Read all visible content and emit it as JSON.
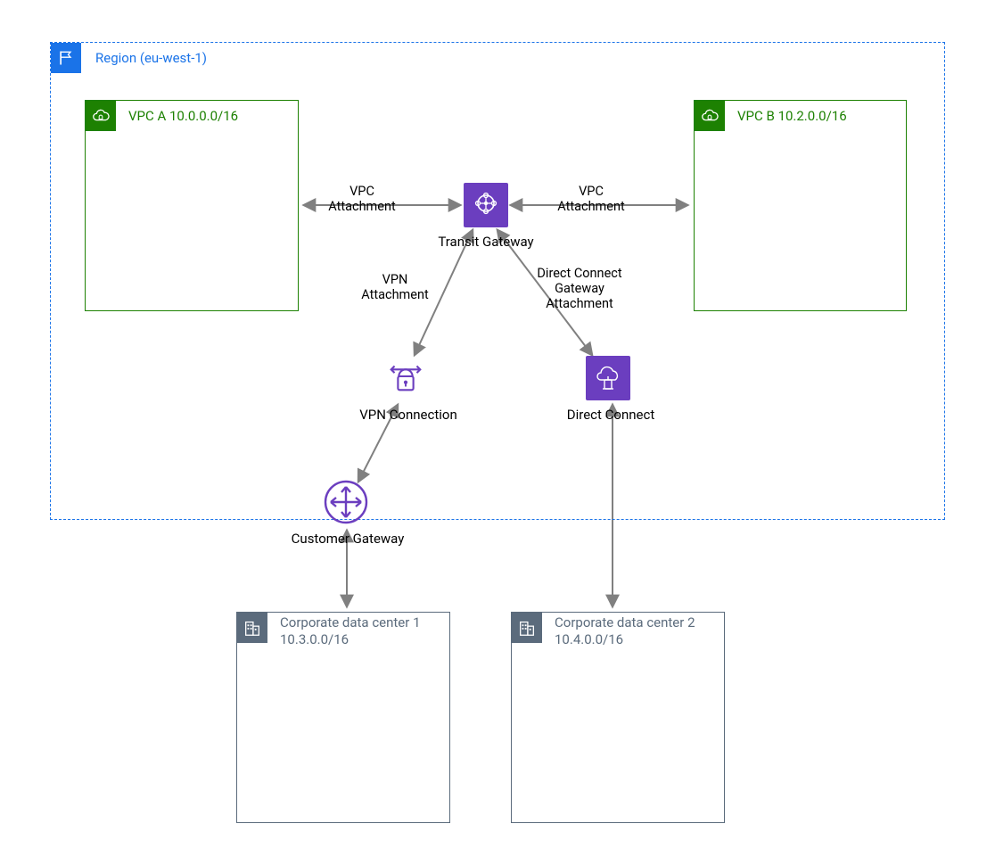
{
  "region": {
    "label": "Region (eu-west-1)"
  },
  "vpc_a": {
    "label": "VPC A 10.0.0.0/16"
  },
  "vpc_b": {
    "label": "VPC B 10.2.0.0/16"
  },
  "tgw": {
    "label": "Transit Gateway"
  },
  "vpn_conn": {
    "label": "VPN Connection"
  },
  "direct_connect": {
    "label": "Direct Connect"
  },
  "customer_gateway": {
    "label": "Customer Gateway"
  },
  "dc1": {
    "title": "Corporate data center 1",
    "cidr": "10.3.0.0/16"
  },
  "dc2": {
    "title": "Corporate data center 2",
    "cidr": "10.4.0.0/16"
  },
  "edge_labels": {
    "vpc_attachment_left": "VPC\nAttachment",
    "vpc_attachment_right": "VPC\nAttachment",
    "vpn_attachment": "VPN\nAttachment",
    "dx_attachment": "Direct Connect\nGateway\nAttachment"
  }
}
